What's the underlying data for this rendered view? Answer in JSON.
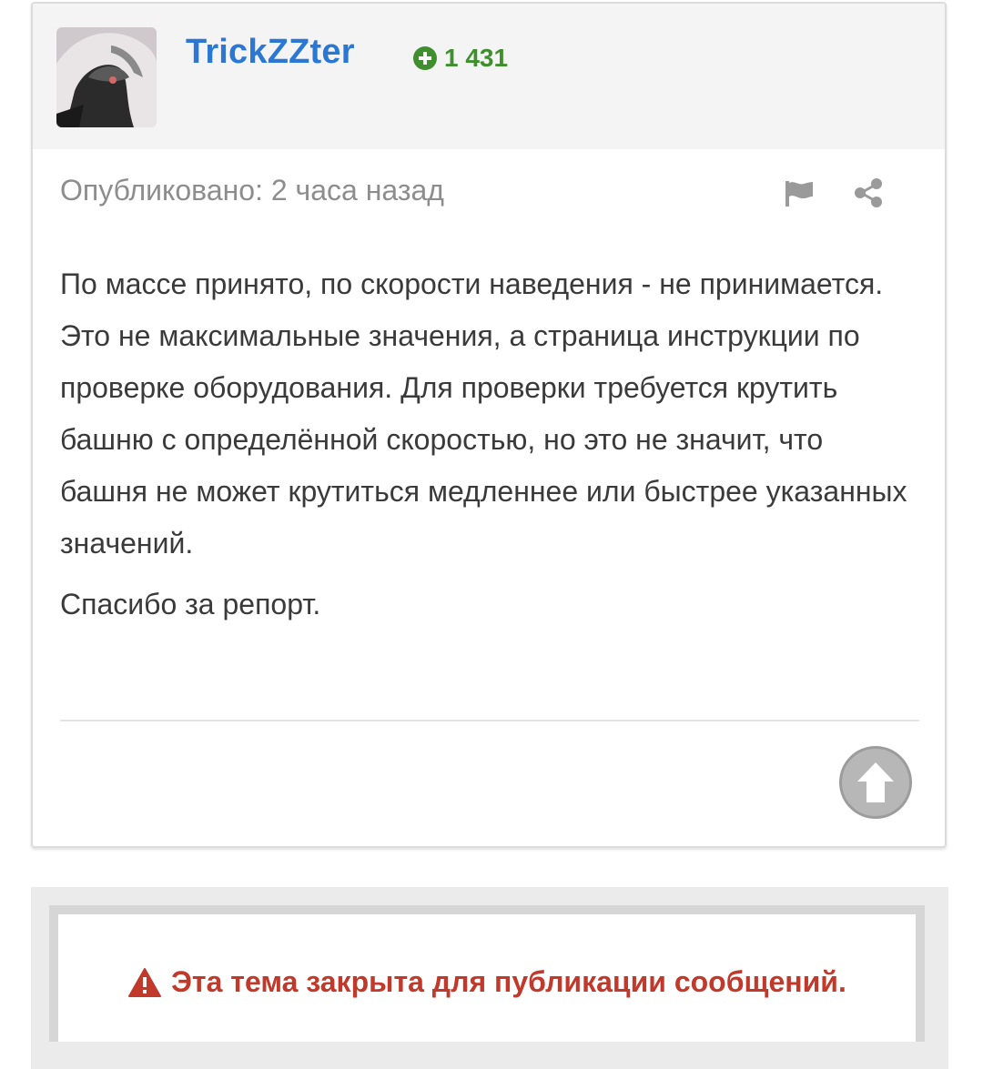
{
  "post": {
    "author": {
      "name": "TrickZZter",
      "reputation": "1 431"
    },
    "published_label": "Опубликовано: 2 часа назад",
    "body_paragraphs": [
      "По массе принято, по скорости наведения - не принимается. Это не максимальные значения, а страница инструкции по проверке оборудования. Для проверки требуется крутить башню с определённой скоростью, но это не значит, что башня не может крутиться медленнее или быстрее указанных значений.",
      "Спасибо за репорт."
    ],
    "icons": {
      "report": "flag-icon",
      "share": "share-icon",
      "upvote": "arrow-up-icon",
      "reputation": "plus-circle-icon"
    }
  },
  "locked_notice": {
    "text": "Эта тема закрыта для публикации сообщений.",
    "icon": "warning-icon"
  },
  "colors": {
    "username": "#2a78d4",
    "reputation": "#3f8f2e",
    "locked": "#c0392b"
  }
}
